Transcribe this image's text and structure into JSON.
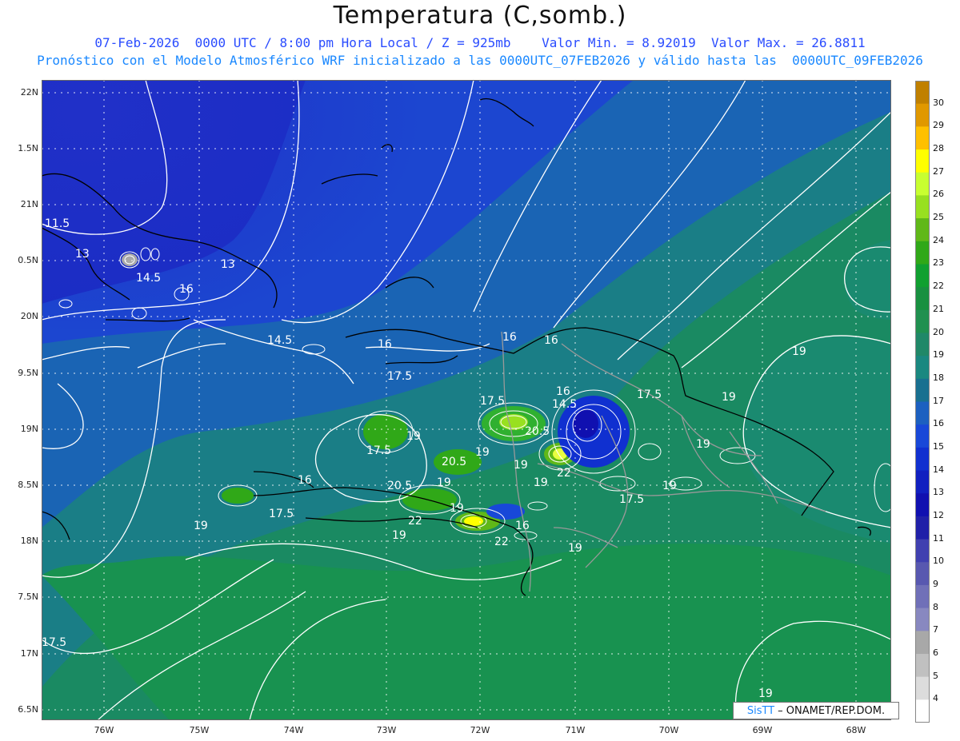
{
  "header": {
    "title": "Temperatura (C,somb.)",
    "line1": "07-Feb-2026  0000 UTC / 8:00 pm Hora Local / Z = 925mb    Valor Min. = 8.92019  Valor Max. = 26.8811",
    "line2": "Pronóstico con el Modelo Atmosférico WRF inicializado a las 0000UTC_07FEB2026 y válido hasta las  0000UTC_09FEB2026"
  },
  "axes": {
    "lat_labels": [
      "22N",
      "1.5N",
      "21N",
      "0.5N",
      "20N",
      "9.5N",
      "19N",
      "8.5N",
      "18N",
      "7.5N",
      "17N",
      "6.5N"
    ],
    "lon_labels": [
      "76W",
      "75W",
      "74W",
      "73W",
      "72W",
      "71W",
      "70W",
      "69W",
      "68W"
    ]
  },
  "colorbar": {
    "labels": [
      "30",
      "29",
      "28",
      "27",
      "26",
      "25",
      "24",
      "23",
      "22",
      "21",
      "20",
      "19",
      "18",
      "17",
      "16",
      "15",
      "14",
      "13",
      "12",
      "11",
      "10",
      "9",
      "8",
      "7",
      "6",
      "5",
      "4"
    ],
    "colors": [
      "#c08000",
      "#e09800",
      "#ffc000",
      "#ffff00",
      "#c8ff30",
      "#98e020",
      "#60b818",
      "#30a818",
      "#10a030",
      "#189040",
      "#209050",
      "#208868",
      "#1a8880",
      "#187090",
      "#1c60c0",
      "#1848d8",
      "#1030d0",
      "#1020c0",
      "#1010b0",
      "#2020a8",
      "#4040b0",
      "#5858b0",
      "#7070b8",
      "#8888c0",
      "#a8a8a8",
      "#c0c0c0",
      "#dcdcdc",
      "#ffffff"
    ]
  },
  "contour_labels": [
    {
      "text": "11.5"
    },
    {
      "text": "13"
    },
    {
      "text": "13"
    },
    {
      "text": "14.5"
    },
    {
      "text": "16"
    },
    {
      "text": "14.5"
    },
    {
      "text": "16"
    },
    {
      "text": "17.5"
    },
    {
      "text": "16"
    },
    {
      "text": "16"
    },
    {
      "text": "17.5"
    },
    {
      "text": "16"
    },
    {
      "text": "14.5"
    },
    {
      "text": "17.5"
    },
    {
      "text": "20.5"
    },
    {
      "text": "19"
    },
    {
      "text": "17.5"
    },
    {
      "text": "19"
    },
    {
      "text": "20.5"
    },
    {
      "text": "19"
    },
    {
      "text": "22"
    },
    {
      "text": "19"
    },
    {
      "text": "16"
    },
    {
      "text": "17.5"
    },
    {
      "text": "20.5"
    },
    {
      "text": "19"
    },
    {
      "text": "22"
    },
    {
      "text": "19"
    },
    {
      "text": "16"
    },
    {
      "text": "22"
    },
    {
      "text": "19"
    },
    {
      "text": "19"
    },
    {
      "text": "19"
    },
    {
      "text": "17.5"
    },
    {
      "text": "19"
    },
    {
      "text": "19"
    },
    {
      "text": "19"
    },
    {
      "text": "19"
    },
    {
      "text": "17.5"
    },
    {
      "text": "19"
    }
  ],
  "credit": {
    "brand": "SisTT",
    "text": "– ONAMET/REP.DOM."
  }
}
